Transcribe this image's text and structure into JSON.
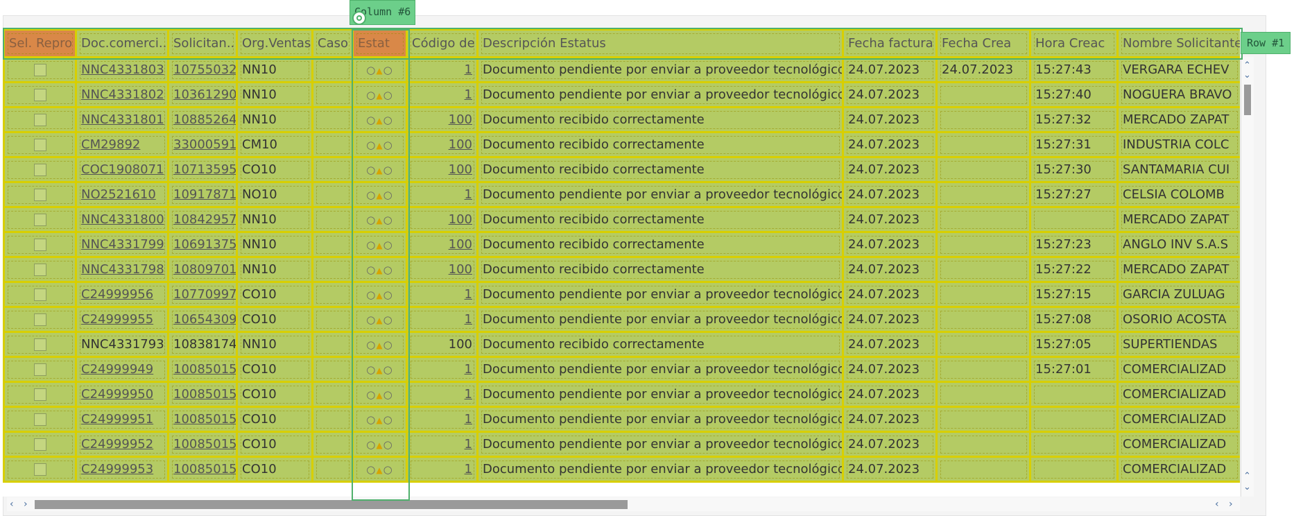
{
  "overlay": {
    "column_label": "Column #6",
    "row_label": "Row #1"
  },
  "columns": [
    "Sel. Repro",
    "Doc.comerci...",
    "Solicitan...",
    "Org.Ventas",
    "Caso",
    "Estat",
    "Código de",
    "Descripción Estatus",
    "Fecha factura",
    "Fecha Crea",
    "Hora Creac",
    "Nombre Solicitante"
  ],
  "rows": [
    {
      "doc": "NNC4331803",
      "sol": "10755032",
      "org": "NN10",
      "code": "1",
      "desc": "Documento pendiente por enviar a proveedor tecnológico",
      "fecha": "24.07.2023",
      "crea": "24.07.2023",
      "hora": "15:27:43",
      "nombre": "VERGARA ECHEV"
    },
    {
      "doc": "NNC4331802",
      "sol": "10361290",
      "org": "NN10",
      "code": "1",
      "desc": "Documento pendiente por enviar a proveedor tecnológico",
      "fecha": "24.07.2023",
      "crea": "",
      "hora": "15:27:40",
      "nombre": "NOGUERA BRAVO"
    },
    {
      "doc": "NNC4331801",
      "sol": "10885264",
      "org": "NN10",
      "code": "100",
      "desc": "Documento recibido correctamente",
      "fecha": "24.07.2023",
      "crea": "",
      "hora": "15:27:32",
      "nombre": "MERCADO ZAPAT"
    },
    {
      "doc": "CM29892",
      "sol": "33000591",
      "org": "CM10",
      "code": "100",
      "desc": "Documento recibido correctamente",
      "fecha": "24.07.2023",
      "crea": "",
      "hora": "15:27:31",
      "nombre": "INDUSTRIA COLC"
    },
    {
      "doc": "COC1908071",
      "sol": "10713595",
      "org": "CO10",
      "code": "100",
      "desc": "Documento recibido correctamente",
      "fecha": "24.07.2023",
      "crea": "",
      "hora": "15:27:30",
      "nombre": "SANTAMARIA CUI"
    },
    {
      "doc": "NO2521610",
      "sol": "10917871",
      "org": "NO10",
      "code": "1",
      "desc": "Documento pendiente por enviar a proveedor tecnológico",
      "fecha": "24.07.2023",
      "crea": "",
      "hora": "15:27:27",
      "nombre": "CELSIA COLOMB"
    },
    {
      "doc": "NNC4331800",
      "sol": "10842957",
      "org": "NN10",
      "code": "100",
      "desc": "Documento recibido correctamente",
      "fecha": "24.07.2023",
      "crea": "",
      "hora": "",
      "nombre": "MERCADO ZAPAT"
    },
    {
      "doc": "NNC4331799",
      "sol": "10691375",
      "org": "NN10",
      "code": "100",
      "desc": "Documento recibido correctamente",
      "fecha": "24.07.2023",
      "crea": "",
      "hora": "15:27:23",
      "nombre": "ANGLO INV S.A.S"
    },
    {
      "doc": "NNC4331798",
      "sol": "10809701",
      "org": "NN10",
      "code": "100",
      "desc": "Documento recibido correctamente",
      "fecha": "24.07.2023",
      "crea": "",
      "hora": "15:27:22",
      "nombre": "MERCADO ZAPAT"
    },
    {
      "doc": "C24999956",
      "sol": "10770997",
      "org": "CO10",
      "code": "1",
      "desc": "Documento pendiente por enviar a proveedor tecnológico",
      "fecha": "24.07.2023",
      "crea": "",
      "hora": "15:27:15",
      "nombre": "GARCIA ZULUAG"
    },
    {
      "doc": "C24999955",
      "sol": "10654309",
      "org": "CO10",
      "code": "1",
      "desc": "Documento pendiente por enviar a proveedor tecnológico",
      "fecha": "24.07.2023",
      "crea": "",
      "hora": "15:27:08",
      "nombre": "OSORIO ACOSTA"
    },
    {
      "doc": "NNC4331793",
      "sol": "10838174",
      "org": "NN10",
      "code": "100",
      "desc": "Documento recibido correctamente",
      "fecha": "24.07.2023",
      "crea": "",
      "hora": "15:27:05",
      "nombre": "SUPERTIENDAS"
    },
    {
      "doc": "C24999949",
      "sol": "10085015",
      "org": "CO10",
      "code": "1",
      "desc": "Documento pendiente por enviar a proveedor tecnológico",
      "fecha": "24.07.2023",
      "crea": "",
      "hora": "15:27:01",
      "nombre": "COMERCIALIZAD"
    },
    {
      "doc": "C24999950",
      "sol": "10085015",
      "org": "CO10",
      "code": "1",
      "desc": "Documento pendiente por enviar a proveedor tecnológico",
      "fecha": "24.07.2023",
      "crea": "",
      "hora": "",
      "nombre": "COMERCIALIZAD"
    },
    {
      "doc": "C24999951",
      "sol": "10085015",
      "org": "CO10",
      "code": "1",
      "desc": "Documento pendiente por enviar a proveedor tecnológico",
      "fecha": "24.07.2023",
      "crea": "",
      "hora": "",
      "nombre": "COMERCIALIZAD"
    },
    {
      "doc": "C24999952",
      "sol": "10085015",
      "org": "CO10",
      "code": "1",
      "desc": "Documento pendiente por enviar a proveedor tecnológico",
      "fecha": "24.07.2023",
      "crea": "",
      "hora": "",
      "nombre": "COMERCIALIZAD"
    },
    {
      "doc": "C24999953",
      "sol": "10085015",
      "org": "CO10",
      "code": "1",
      "desc": "Documento pendiente por enviar a proveedor tecnológico",
      "fecha": "24.07.2023",
      "crea": "",
      "hora": "",
      "nombre": "COMERCIALIZAD"
    }
  ],
  "icons": {
    "status": "circle-triangle-circle-icon",
    "sort": "sort-desc-icon",
    "target": "target-icon",
    "scroll_up": "chevron-up-icon",
    "scroll_down": "chevron-down-icon",
    "scroll_left": "chevron-left-icon",
    "scroll_right": "chevron-right-icon"
  },
  "colors": {
    "highlight_fill": "#b4cb64",
    "highlight_border": "#d8cf00",
    "selected_header": "#d98848",
    "overlay_green": "#6ccf8a"
  }
}
